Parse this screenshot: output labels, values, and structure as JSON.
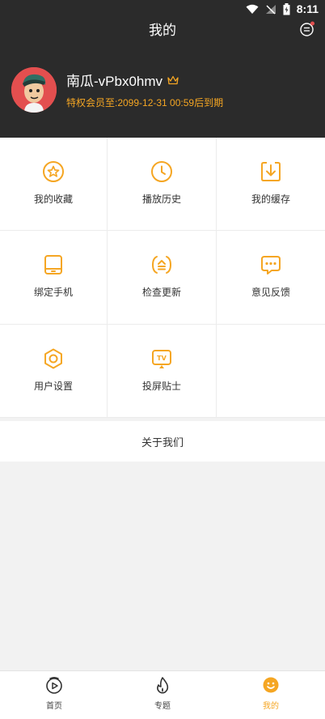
{
  "status": {
    "time": "8:11"
  },
  "header": {
    "title": "我的"
  },
  "profile": {
    "username": "南瓜-vPbx0hmv",
    "vip_text": "特权会员至:2099-12-31 00:59后到期"
  },
  "grid": [
    {
      "label": "我的收藏",
      "icon": "star-icon"
    },
    {
      "label": "播放历史",
      "icon": "clock-icon"
    },
    {
      "label": "我的缓存",
      "icon": "download-icon"
    },
    {
      "label": "绑定手机",
      "icon": "tablet-icon"
    },
    {
      "label": "检查更新",
      "icon": "update-icon"
    },
    {
      "label": "意见反馈",
      "icon": "chat-icon"
    },
    {
      "label": "用户设置",
      "icon": "settings-icon"
    },
    {
      "label": "投屏贴士",
      "icon": "tv-icon"
    }
  ],
  "about": {
    "label": "关于我们"
  },
  "tabbar": [
    {
      "label": "首页",
      "icon": "play-icon"
    },
    {
      "label": "专题",
      "icon": "flame-icon"
    },
    {
      "label": "我的",
      "icon": "smile-icon",
      "active": true
    }
  ],
  "colors": {
    "accent": "#f5a623",
    "header_bg": "#2b2b2b",
    "avatar_bg": "#e34f4f"
  }
}
